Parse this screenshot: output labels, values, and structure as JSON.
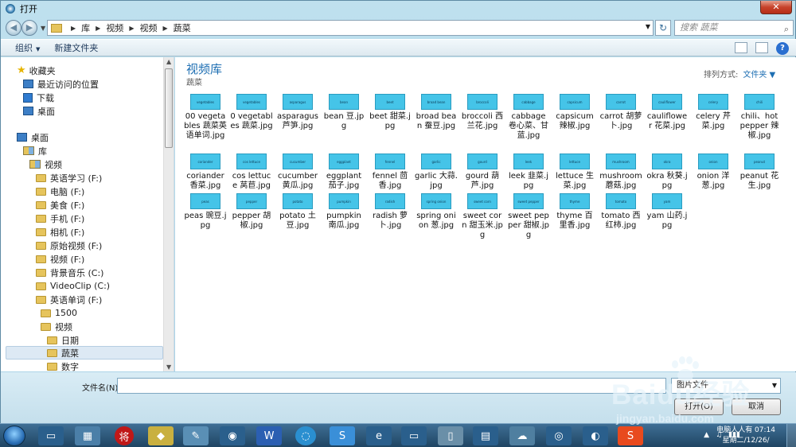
{
  "window": {
    "title": "打开",
    "close": "✕"
  },
  "nav": {
    "path": [
      "库",
      "视频",
      "视频",
      "蔬菜"
    ],
    "search_placeholder": "搜索 蔬菜"
  },
  "toolbar": {
    "organize": "组织",
    "new_folder": "新建文件夹"
  },
  "sidebar": {
    "favorites": "收藏夹",
    "recent": "最近访问的位置",
    "downloads": "下载",
    "desktop1": "桌面",
    "desktop2": "桌面",
    "libraries": "库",
    "video": "视频",
    "folders": [
      "英语学习 (F:)",
      "电脑 (F:)",
      "美食 (F:)",
      "手机 (F:)",
      "相机 (F:)",
      "原始视频 (F:)",
      "视频 (F:)",
      "背景音乐 (C:)",
      "VideoClip (C:)",
      "英语单词 (F:)"
    ],
    "sub1": "1500",
    "sub2": "视频",
    "sub3": [
      "日期",
      "蔬菜",
      "数字"
    ]
  },
  "content": {
    "library_title": "视频库",
    "library_sub": "蔬菜",
    "arrange_label": "排列方式:",
    "arrange_value": "文件夹"
  },
  "files": [
    {
      "name": "00 vegetables 蔬菜英语单词.jpg",
      "thumb": "vegetables"
    },
    {
      "name": "0 vegetables 蔬菜.jpg",
      "thumb": "vegetables"
    },
    {
      "name": "asparagus 芦笋.jpg",
      "thumb": "asparagus"
    },
    {
      "name": "bean 豆.jpg",
      "thumb": "bean"
    },
    {
      "name": "beet 甜菜.jpg",
      "thumb": "beet"
    },
    {
      "name": "broad bean 蚕豆.jpg",
      "thumb": "broad bean"
    },
    {
      "name": "broccoli 西兰花.jpg",
      "thumb": "broccoli"
    },
    {
      "name": "cabbage 卷心菜、甘蓝.jpg",
      "thumb": "cabbage"
    },
    {
      "name": "capsicum 辣椒.jpg",
      "thumb": "capsicum"
    },
    {
      "name": "carrot 胡萝卜.jpg",
      "thumb": "carrot"
    },
    {
      "name": "cauliflower 花菜.jpg",
      "thumb": "cauliflower"
    },
    {
      "name": "celery 芹菜.jpg",
      "thumb": "celery"
    },
    {
      "name": "chili、hot pepper 辣椒.jpg",
      "thumb": "chili"
    },
    {
      "name": "coriander 香菜.jpg",
      "thumb": "coriander"
    },
    {
      "name": "cos lettuce 莴苣.jpg",
      "thumb": "cos lettuce"
    },
    {
      "name": "cucumber 黄瓜.jpg",
      "thumb": "cucumber"
    },
    {
      "name": "eggplant 茄子.jpg",
      "thumb": "eggplant"
    },
    {
      "name": "fennel 茴香.jpg",
      "thumb": "fennel"
    },
    {
      "name": "garlic 大蒜.jpg",
      "thumb": "garlic"
    },
    {
      "name": "gourd 葫芦.jpg",
      "thumb": "gourd"
    },
    {
      "name": "leek 韭菜.jpg",
      "thumb": "leek"
    },
    {
      "name": "lettuce 生菜.jpg",
      "thumb": "lettuce"
    },
    {
      "name": "mushroom 蘑菇.jpg",
      "thumb": "mushroom"
    },
    {
      "name": "okra 秋葵.jpg",
      "thumb": "okra"
    },
    {
      "name": "onion 洋葱.jpg",
      "thumb": "onion"
    },
    {
      "name": "peanut 花生.jpg",
      "thumb": "peanut"
    },
    {
      "name": "peas 豌豆.jpg",
      "thumb": "peas"
    },
    {
      "name": "pepper 胡椒.jpg",
      "thumb": "pepper"
    },
    {
      "name": "potato 土豆.jpg",
      "thumb": "potato"
    },
    {
      "name": "pumpkin 南瓜.jpg",
      "thumb": "pumpkin"
    },
    {
      "name": "radish 萝卜.jpg",
      "thumb": "radish"
    },
    {
      "name": "spring onion 葱.jpg",
      "thumb": "spring onion"
    },
    {
      "name": "sweet corn 甜玉米.jpg",
      "thumb": "sweet corn"
    },
    {
      "name": "sweet pepper 甜椒.jpg",
      "thumb": "sweet pepper"
    },
    {
      "name": "thyme 百里香.jpg",
      "thumb": "thyme"
    },
    {
      "name": "tomato 西红柿.jpg",
      "thumb": "tomato"
    },
    {
      "name": "yam 山药.jpg",
      "thumb": "yam"
    }
  ],
  "footer": {
    "filename_label": "文件名(N):",
    "filename_value": "",
    "filetype_value": "图片文件",
    "open_btn": "打开(O)",
    "cancel_btn": "取消"
  },
  "taskbar": {
    "tray": [
      "▲",
      "♫",
      "▮▮▮"
    ],
    "clock_line1": "电脑人人有 07:14",
    "clock_line2": "星期二/12/26/"
  },
  "watermark": {
    "brand": "Baidu经验",
    "url": "jingyan.baidu.com"
  },
  "colors": {
    "accent": "#1e6fb3",
    "thumb": "#45c4e8",
    "folder": "#e6c45c"
  }
}
